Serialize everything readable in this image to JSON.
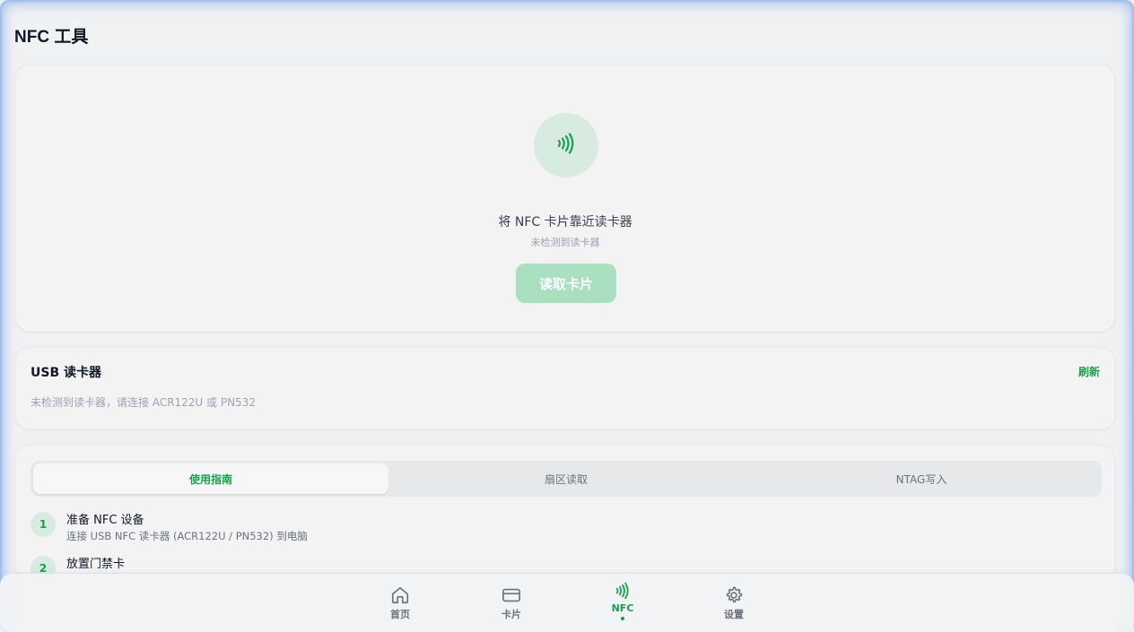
{
  "header": {
    "title": "NFC 工具"
  },
  "scan": {
    "icon": "nfc-waves-icon",
    "title": "将 NFC 卡片靠近读卡器",
    "subtitle": "未检测到读卡器",
    "read_button": "读取卡片"
  },
  "usb": {
    "title": "USB 读卡器",
    "refresh": "刷新",
    "message": "未检测到读卡器，请连接 ACR122U 或 PN532"
  },
  "guide": {
    "tabs": [
      {
        "label": "使用指南",
        "active": true
      },
      {
        "label": "扇区读取",
        "active": false
      },
      {
        "label": "NTAG写入",
        "active": false
      }
    ],
    "steps": [
      {
        "num": "1",
        "title": "准备 NFC 设备",
        "desc": "连接 USB NFC 读卡器 (ACR122U / PN532) 到电脑"
      },
      {
        "num": "2",
        "title": "放置门禁卡",
        "desc": ""
      }
    ]
  },
  "nav": {
    "items": [
      {
        "label": "首页",
        "icon": "home-icon"
      },
      {
        "label": "卡片",
        "icon": "card-icon"
      },
      {
        "label": "NFC",
        "icon": "nfc-icon",
        "active": true
      },
      {
        "label": "设置",
        "icon": "gear-icon"
      }
    ]
  },
  "colors": {
    "accent": "#16a34a",
    "accent_light": "#d7ebe0",
    "button_disabled": "#a8e0c0"
  }
}
